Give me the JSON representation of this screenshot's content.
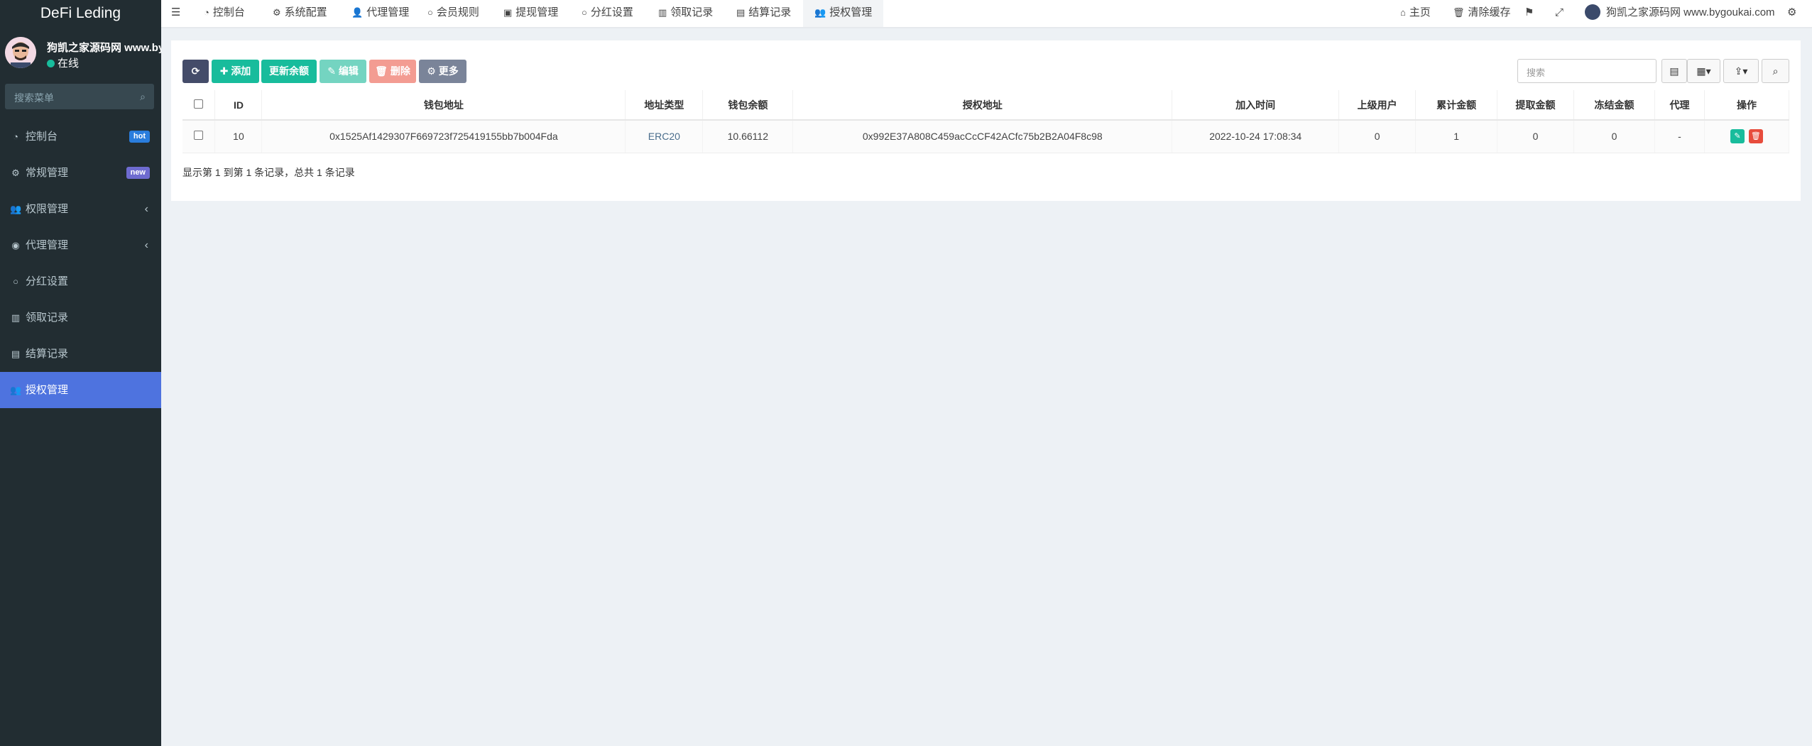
{
  "app": {
    "brand": "DeFi Leding"
  },
  "user": {
    "name": "狗凯之家源码网 www.bygoukai.com",
    "status": "在线"
  },
  "sidebar": {
    "search_placeholder": "搜索菜单",
    "items": [
      {
        "label": "控制台",
        "icon": "dashboard-icon",
        "badge": "hot"
      },
      {
        "label": "常规管理",
        "icon": "cogs-icon",
        "badge": "new"
      },
      {
        "label": "权限管理",
        "icon": "users-icon",
        "chevron": "‹"
      },
      {
        "label": "代理管理",
        "icon": "user-circle-icon",
        "chevron": "‹"
      },
      {
        "label": "分红设置",
        "icon": "circle-icon"
      },
      {
        "label": "领取记录",
        "icon": "bar-chart-icon"
      },
      {
        "label": "结算记录",
        "icon": "list-alt-icon"
      },
      {
        "label": "授权管理",
        "icon": "users-icon",
        "active": true
      }
    ]
  },
  "topnav": {
    "items": [
      {
        "label": "控制台",
        "icon": "dashboard-icon"
      },
      {
        "label": "系统配置",
        "icon": "cog-icon"
      },
      {
        "label": "代理管理",
        "icon": "user-icon"
      },
      {
        "label": "会员规则",
        "icon": "circle-icon"
      },
      {
        "label": "提现管理",
        "icon": "image-icon"
      },
      {
        "label": "分红设置",
        "icon": "circle-icon"
      },
      {
        "label": "领取记录",
        "icon": "bar-chart-icon"
      },
      {
        "label": "结算记录",
        "icon": "list-alt-icon"
      },
      {
        "label": "授权管理",
        "icon": "users-icon",
        "active": true
      }
    ],
    "right": {
      "home": "主页",
      "clear_cache": "清除缓存",
      "user_name": "狗凯之家源码网 www.bygoukai.com"
    }
  },
  "toolbar": {
    "add": "添加",
    "update_balance": "更新余额",
    "edit": "编辑",
    "delete": "删除",
    "more": "更多",
    "search_placeholder": "搜索"
  },
  "table": {
    "columns": [
      "ID",
      "钱包地址",
      "地址类型",
      "钱包余额",
      "授权地址",
      "加入时间",
      "上级用户",
      "累计金额",
      "提取金额",
      "冻结金额",
      "代理",
      "操作"
    ],
    "rows": [
      {
        "id": "10",
        "wallet": "0x1525Af1429307F669723f725419155bb7b004Fda",
        "type": "ERC20",
        "balance": "10.66112",
        "auth": "0x992E37A808C459acCcCF42ACfc75b2B2A04F8c98",
        "joined": "2022-10-24 17:08:34",
        "parent": "0",
        "total": "1",
        "withdrawn": "0",
        "frozen": "0",
        "agent": "-"
      }
    ]
  },
  "pager": {
    "info": "显示第 1 到第 1 条记录，总共 1 条记录"
  },
  "colors": {
    "sidebar_bg": "#222d32",
    "active": "#4e73df",
    "success": "#18bc9c",
    "danger": "#e74c3c"
  }
}
